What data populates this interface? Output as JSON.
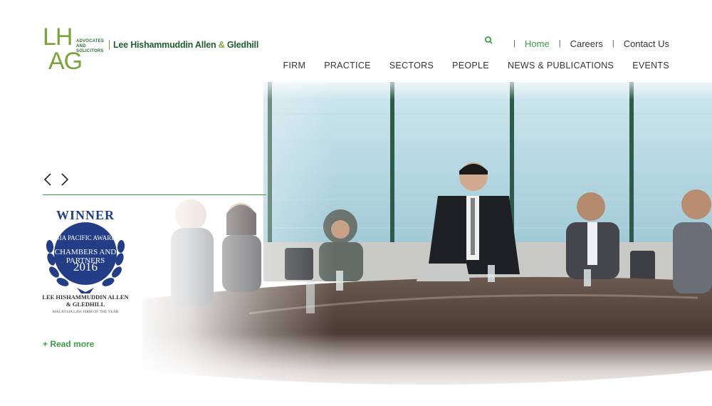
{
  "header": {
    "logo": {
      "mark_top": "LH",
      "mark_bottom": "AG",
      "tagline": "ADVOCATES AND SOLICITORS",
      "name_part1": "Lee Hishammuddin Allen ",
      "name_amp": "&",
      "name_part2": " Gledhill"
    },
    "top_nav": [
      {
        "label": "Home",
        "active": true
      },
      {
        "label": "Careers",
        "active": false
      },
      {
        "label": "Contact Us",
        "active": false
      }
    ],
    "main_nav": [
      "FIRM",
      "PRACTICE",
      "SECTORS",
      "PEOPLE",
      "NEWS & PUBLICATIONS",
      "EVENTS"
    ]
  },
  "award": {
    "winner": "WINNER",
    "line1": "ASIA PACIFIC AWARDS",
    "line2": "CHAMBERS AND PARTNERS",
    "year": "2016",
    "firm": "LEE HISHAMMUDDIN ALLEN & GLEDHILL",
    "subtitle": "MALAYSIA LAW FIRM OF THE YEAR"
  },
  "read_more": "+ Read more",
  "colors": {
    "accent_green": "#3aa046",
    "logo_green": "#7aa33a",
    "award_blue": "#233d86"
  },
  "icons": {
    "search": "search-icon",
    "prev": "chevron-left-icon",
    "next": "chevron-right-icon"
  }
}
